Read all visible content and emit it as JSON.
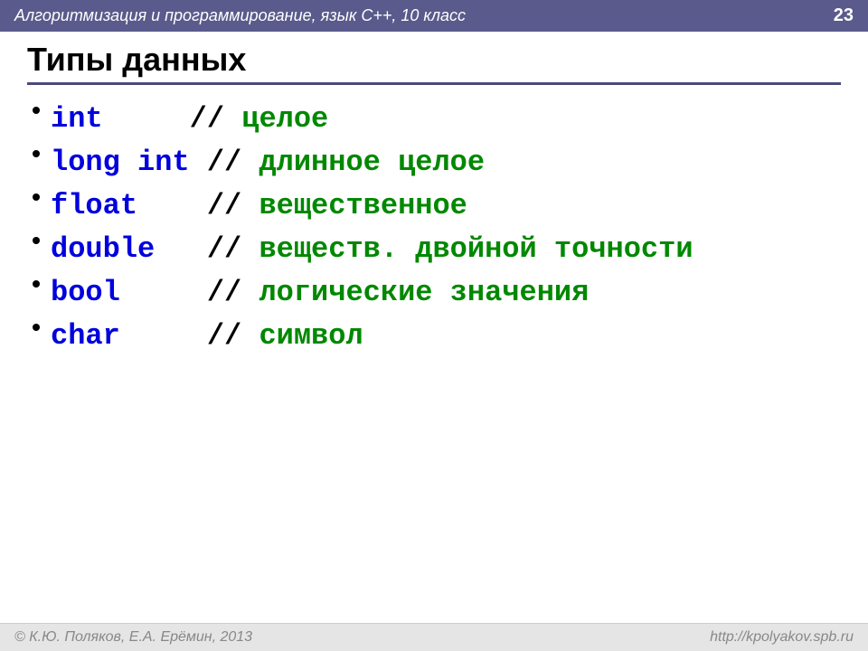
{
  "header": {
    "course_title": "Алгоритмизация и программирование, язык  C++, 10 класс",
    "page_number": "23"
  },
  "slide": {
    "title": "Типы данных",
    "items": [
      {
        "keyword": "int     ",
        "mark": "// ",
        "comment": "целое"
      },
      {
        "keyword": "long int",
        "mark": " // ",
        "comment": "длинное целое"
      },
      {
        "keyword": "float   ",
        "mark": " // ",
        "comment": "вещественное"
      },
      {
        "keyword": "double  ",
        "mark": " // ",
        "comment": "веществ. двойной точности"
      },
      {
        "keyword": "bool    ",
        "mark": " // ",
        "comment": "логические значения"
      },
      {
        "keyword": "char    ",
        "mark": " // ",
        "comment": "символ"
      }
    ]
  },
  "footer": {
    "copyright": "© К.Ю. Поляков, Е.А. Ерёмин, 2013",
    "url": "http://kpolyakov.spb.ru"
  }
}
